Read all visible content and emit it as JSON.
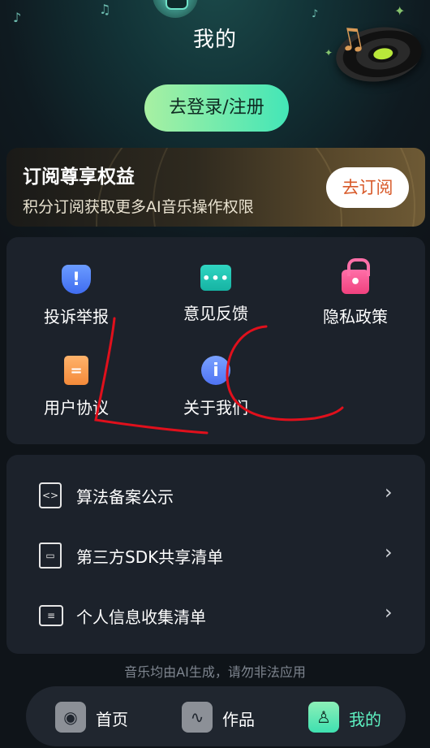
{
  "header": {
    "title": "我的",
    "login_button": "去登录/注册"
  },
  "subscription": {
    "title": "订阅尊享权益",
    "description": "积分订阅获取更多AI音乐操作权限",
    "button": "去订阅"
  },
  "grid": [
    {
      "label": "投诉举报",
      "icon": "shield-alert-icon"
    },
    {
      "label": "意见反馈",
      "icon": "chat-bubble-icon"
    },
    {
      "label": "隐私政策",
      "icon": "lock-icon"
    },
    {
      "label": "用户协议",
      "icon": "document-icon"
    },
    {
      "label": "关于我们",
      "icon": "info-icon"
    }
  ],
  "list": [
    {
      "label": "算法备案公示",
      "icon": "code-document-icon"
    },
    {
      "label": "第三方SDK共享清单",
      "icon": "inbox-tray-icon"
    },
    {
      "label": "个人信息收集清单",
      "icon": "id-card-icon"
    }
  ],
  "footnote": "音乐均由AI生成，请勿非法应用",
  "tabbar": {
    "tabs": [
      {
        "label": "首页",
        "icon": "home-disc-icon",
        "active": false
      },
      {
        "label": "作品",
        "icon": "waveform-icon",
        "active": false
      },
      {
        "label": "我的",
        "icon": "user-icon",
        "active": true
      }
    ]
  },
  "colors": {
    "accent": "#43e6b7",
    "background": "#0f1419",
    "card": "#1c222b",
    "subscribe_button_text": "#d85a2a",
    "annotation_ink": "#e0101c"
  }
}
